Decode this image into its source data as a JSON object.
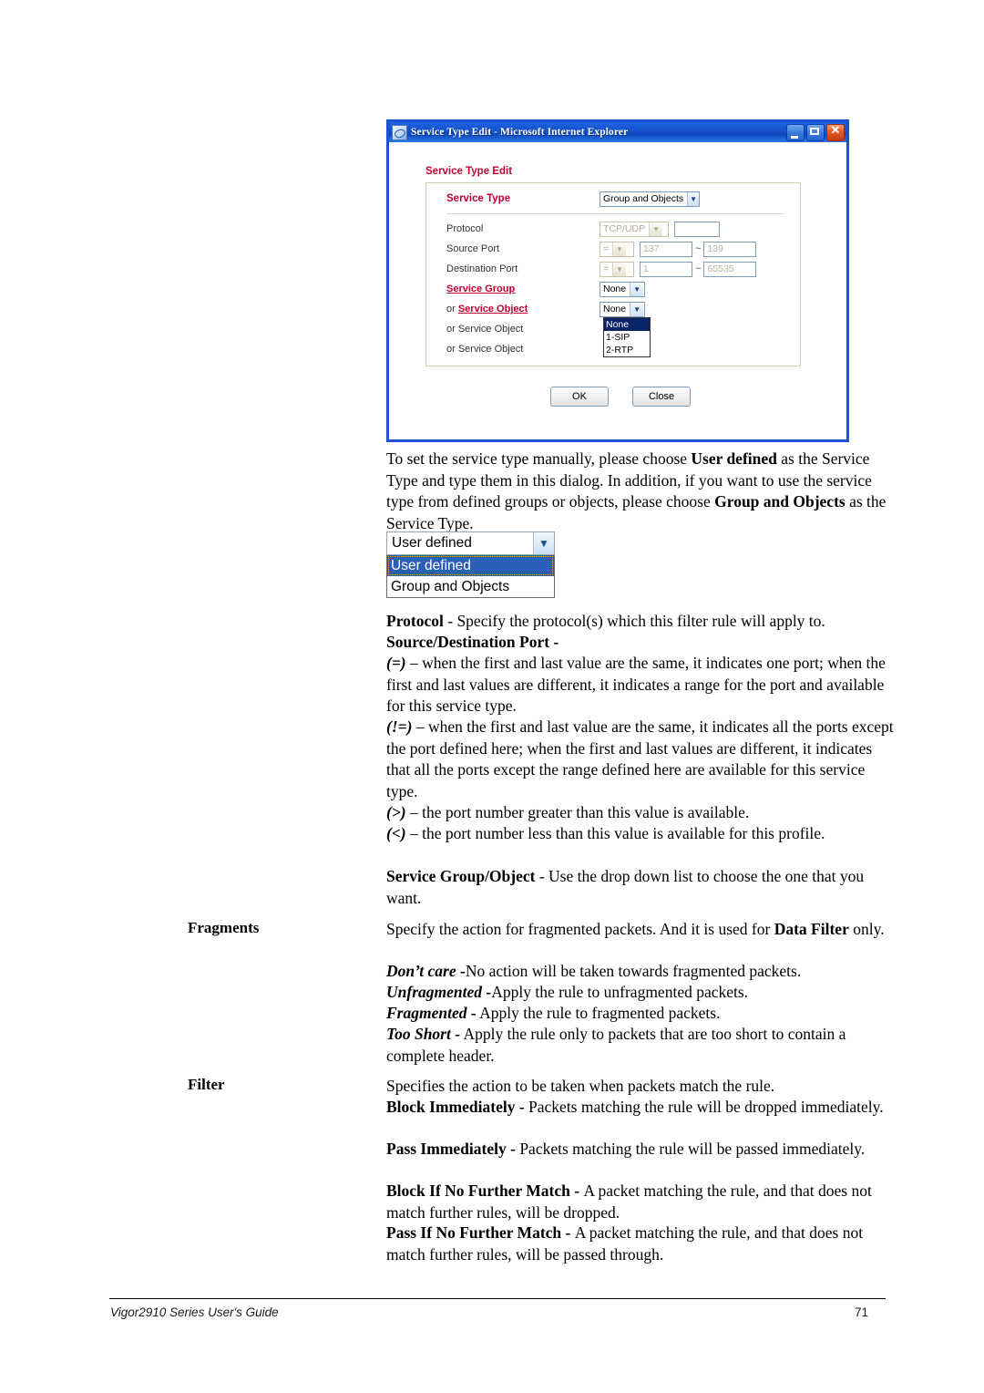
{
  "dialog": {
    "title": "Service Type Edit - Microsoft Internet Explorer",
    "window_buttons": {
      "minimize": "_",
      "maximize": "□",
      "close": "✕"
    },
    "form_title": "Service Type Edit",
    "rows": {
      "service_type": {
        "label": "Service Type",
        "value": "Group and Objects"
      },
      "protocol": {
        "label": "Protocol",
        "value": "TCP/UDP",
        "extra_value": ""
      },
      "source_port": {
        "label": "Source Port",
        "op": "=",
        "start": "137",
        "tilde": "~",
        "end": "139"
      },
      "destination_port": {
        "label": "Destination Port",
        "op": "=",
        "start": "1",
        "tilde": "~",
        "end": "65535"
      },
      "service_group": {
        "label": "Service Group",
        "value": "None"
      },
      "service_object_1": {
        "label_prefix": "or ",
        "label": "Service Object",
        "value": "None"
      },
      "service_object_2": {
        "label": "or Service Object"
      },
      "service_object_3": {
        "label": "or Service Object"
      }
    },
    "open_list": {
      "options": [
        "None",
        "1-SIP",
        "2-RTP"
      ],
      "selected": "None"
    },
    "buttons": {
      "ok": "OK",
      "close": "Close"
    }
  },
  "service_type_dropdown": {
    "selected": "User defined",
    "options": [
      "User defined",
      "Group and Objects"
    ]
  },
  "body": {
    "intro": {
      "l1_a": "To set the service type manually, please choose ",
      "l1_b": "User defined",
      "l1_c": " as",
      "l2": "the Service Type and type them in this dialog. In addition, if you",
      "l3": "want to use the service type from defined groups or objects, please",
      "l4_a": "choose ",
      "l4_b": "Group and Objects",
      "l4_c": " as the Service Type."
    },
    "protocol": {
      "label": "Protocol",
      "dash": " - ",
      "desc": "Specify the protocol(s) which this filter rule will apply to."
    },
    "srcdst": {
      "label": "Source/Destination Port -"
    },
    "operators": [
      {
        "sym": "(=)",
        "text": " – when the first and last value are the same, it indicates one port; when the first and last values are different, it indicates a range for the port and available for this service type."
      },
      {
        "sym": "(!=)",
        "text": " – when the first and last value are the same, it indicates all the ports except the port defined here; when the first and last values are different, it indicates that all the ports except the range defined here are available for this service type."
      },
      {
        "sym": "(>)",
        "text": " – the port number greater than this value is available."
      },
      {
        "sym": "(<)",
        "text": " – the port number less than this value is available for this profile."
      }
    ],
    "service_group_object": {
      "label": "Service Group/Object",
      "dash": " - ",
      "desc": "Use the drop down list to choose the one that you want."
    },
    "fragments": {
      "term": "Fragments",
      "intro_a": "Specify the action for fragmented packets. And it is used for ",
      "intro_b": "Data Filter",
      "intro_c": " only.",
      "items": [
        {
          "name": "Don’t care -",
          "desc": "No action will be taken towards fragmented packets."
        },
        {
          "name": "Unfragmented -",
          "desc": "Apply the rule to unfragmented packets."
        },
        {
          "name": "Fragmented -",
          "desc": " Apply the rule to fragmented packets."
        },
        {
          "name": "Too Short -",
          "desc": " Apply the rule only to packets that are too short to contain a complete header."
        }
      ]
    },
    "filter": {
      "term": "Filter",
      "intro": "Specifies the action to be taken when packets match the rule.",
      "items": [
        {
          "name": "Block Immediately - ",
          "desc": "Packets matching the rule will be dropped immediately."
        },
        {
          "name": "Pass Immediately - ",
          "desc": "Packets matching the rule will be passed immediately."
        },
        {
          "name": "Block If No Further Match - ",
          "desc": "A packet matching the rule, and that does not match further rules, will be dropped."
        },
        {
          "name": "Pass If No Further Match - ",
          "desc": "A packet matching the rule, and that does not match further rules, will be passed through."
        }
      ]
    }
  },
  "footer": {
    "left": "Vigor2910 Series User's Guide",
    "page": "71"
  }
}
